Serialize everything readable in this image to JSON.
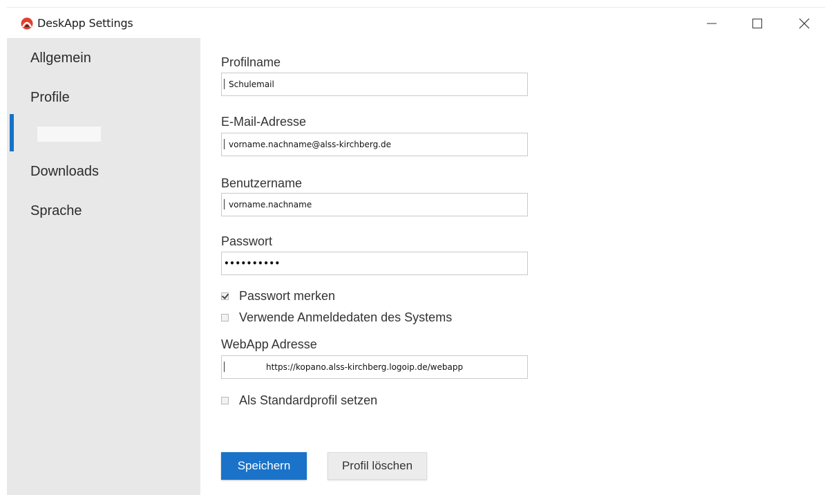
{
  "window": {
    "title": "DeskApp Settings"
  },
  "sidebar": {
    "items": [
      {
        "label": "Allgemein"
      },
      {
        "label": "Profile"
      },
      {
        "label": ""
      },
      {
        "label": "Downloads"
      },
      {
        "label": "Sprache"
      }
    ]
  },
  "form": {
    "profilname": {
      "label": "Profilname",
      "value": "Schulemail"
    },
    "email": {
      "label": "E-Mail-Adresse",
      "value": "vorname.nachname@alss-kirchberg.de"
    },
    "benutzername": {
      "label": "Benutzername",
      "value": "vorname.nachname"
    },
    "passwort": {
      "label": "Passwort",
      "value": "••••••••••"
    },
    "passwort_merken": {
      "label": "Passwort merken",
      "checked": true
    },
    "systemdaten": {
      "label": "Verwende Anmeldedaten des Systems",
      "checked": false
    },
    "webapp": {
      "label": "WebApp Adresse",
      "value": "https://kopano.alss-kirchberg.logoip.de/webapp"
    },
    "standardprofil": {
      "label": "Als Standardprofil setzen",
      "checked": false
    }
  },
  "buttons": {
    "save": "Speichern",
    "delete": "Profil löschen"
  },
  "colors": {
    "accent": "#1a73c8",
    "sidebar_bg": "#e8e8e8"
  },
  "icons": {
    "app": "deskapp-logo-icon",
    "minimize": "minimize-icon",
    "maximize": "maximize-icon",
    "close": "close-icon"
  }
}
